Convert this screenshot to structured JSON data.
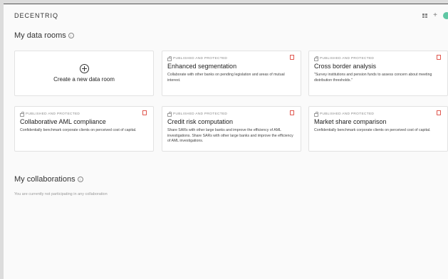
{
  "app": {
    "logo": "DECENTRIQ",
    "actions": [
      {
        "icon": "grid-icon"
      },
      {
        "icon": "plus-icon",
        "label": "+"
      },
      {
        "icon": "avatar"
      }
    ]
  },
  "data_rooms": {
    "title": "My data rooms",
    "info_icon": "i",
    "create_label": "Create a new data room",
    "cards": [
      {
        "status": "PUBLISHED AND PROTECTED",
        "title": "Enhanced segmentation",
        "description": "Collaborate with other banks on pending legislation and areas of mutual interest."
      },
      {
        "status": "PUBLISHED AND PROTECTED",
        "title": "Cross border analysis",
        "description": "\"Survey institutions and pension funds to assess concern about meeting distribution thresholds.\""
      },
      {
        "status": "PUBLISHED AND PROTECTED",
        "title": "Collaborative AML compliance",
        "description": "Confidentially benchmark corporate clients on perceived cost of capital."
      },
      {
        "status": "PUBLISHED AND PROTECTED",
        "title": "Credit risk computation",
        "description": "Share SARs with other large banks and improve the efficiency of AML investigations. Share SARs with other large banks and improve the efficiency of AML investigations."
      },
      {
        "status": "PUBLISHED AND PROTECTED",
        "title": "Market share comparison",
        "description": "Confidentially benchmark corporate clients on perceived cost of capital."
      }
    ]
  },
  "collaborations": {
    "title": "My collaborations",
    "info_icon": "i",
    "empty_text": "You are currently not participating in any collaboration"
  },
  "colors": {
    "accent": "#5fc7a4",
    "danger": "#e0574f"
  }
}
